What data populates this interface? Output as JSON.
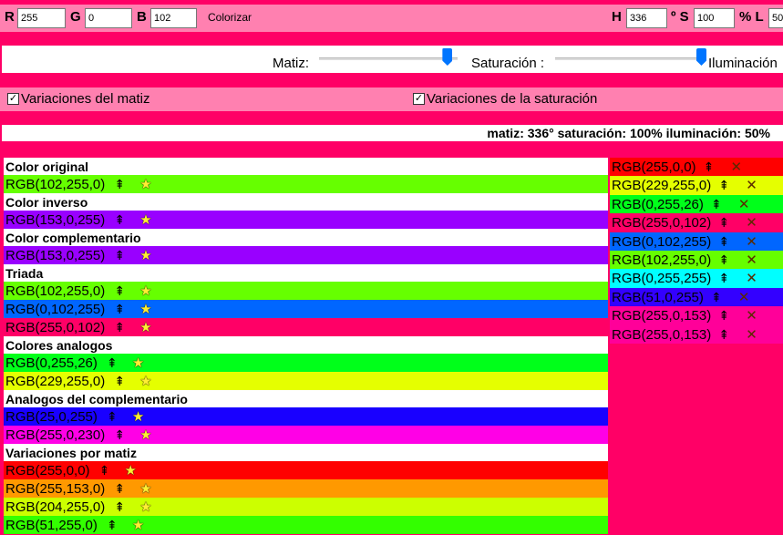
{
  "controls": {
    "r_label": "R",
    "r_value": "255",
    "g_label": "G",
    "g_value": "0",
    "b_label": "B",
    "b_value": "102",
    "colorize_label": "Colorizar",
    "h_label": "H",
    "h_value": "336",
    "deg_s_label": "º S",
    "s_value": "100",
    "pct_l_label": "% L",
    "l_value": "50"
  },
  "sliders": {
    "hue_label": "Matiz:",
    "saturation_label": "Saturación :",
    "lightness_label": "Iluminación",
    "hue_position": 0.93,
    "saturation_position": 1.0
  },
  "checkboxes": {
    "hue_variations": {
      "label": "Variaciones del matiz",
      "checked": true,
      "mark": "✓"
    },
    "saturation_variations": {
      "label": "Variaciones de la saturación",
      "checked": true,
      "mark": "✓"
    }
  },
  "info": {
    "summary": "matiz: 336° saturación: 100% iluminación: 50%"
  },
  "icons": {
    "pin": "pin-icon",
    "star": "star-icon",
    "remove": "remove-x-icon"
  },
  "left_list": {
    "sections": [
      {
        "title": "Color original",
        "rows": [
          {
            "text": "RGB(102,255,0)",
            "color": "#66ff00"
          }
        ]
      },
      {
        "title": "Color inverso",
        "rows": [
          {
            "text": "RGB(153,0,255)",
            "color": "#9900ff"
          }
        ]
      },
      {
        "title": "Color complementario",
        "rows": [
          {
            "text": "RGB(153,0,255)",
            "color": "#9900ff"
          }
        ]
      },
      {
        "title": "Triada",
        "rows": [
          {
            "text": "RGB(102,255,0)",
            "color": "#66ff00"
          },
          {
            "text": "RGB(0,102,255)",
            "color": "#0066ff"
          },
          {
            "text": "RGB(255,0,102)",
            "color": "#ff0066"
          }
        ]
      },
      {
        "title": "Colores analogos",
        "rows": [
          {
            "text": "RGB(0,255,26)",
            "color": "#00ff1a"
          },
          {
            "text": "RGB(229,255,0)",
            "color": "#e5ff00"
          }
        ]
      },
      {
        "title": "Analogos del complementario",
        "rows": [
          {
            "text": "RGB(25,0,255)",
            "color": "#1900ff"
          },
          {
            "text": "RGB(255,0,230)",
            "color": "#ff00e6"
          }
        ]
      },
      {
        "title": "Variaciones por matiz",
        "rows": [
          {
            "text": "RGB(255,0,0)",
            "color": "#ff0000"
          },
          {
            "text": "RGB(255,153,0)",
            "color": "#ff9900"
          },
          {
            "text": "RGB(204,255,0)",
            "color": "#ccff00"
          },
          {
            "text": "RGB(51,255,0)",
            "color": "#33ff00"
          }
        ]
      }
    ]
  },
  "right_list": [
    {
      "text": "RGB(255,0,0)",
      "color": "#ff0000"
    },
    {
      "text": "RGB(229,255,0)",
      "color": "#e5ff00"
    },
    {
      "text": "RGB(0,255,26)",
      "color": "#00ff1a"
    },
    {
      "text": "RGB(255,0,102)",
      "color": "#ff0066"
    },
    {
      "text": "RGB(0,102,255)",
      "color": "#0066ff"
    },
    {
      "text": "RGB(102,255,0)",
      "color": "#66ff00"
    },
    {
      "text": "RGB(0,255,255)",
      "color": "#00ffff"
    },
    {
      "text": "RGB(51,0,255)",
      "color": "#3300ff"
    },
    {
      "text": "RGB(255,0,153)",
      "color": "#ff0099"
    },
    {
      "text": "RGB(255,0,153)",
      "color": "#ff0099"
    }
  ]
}
